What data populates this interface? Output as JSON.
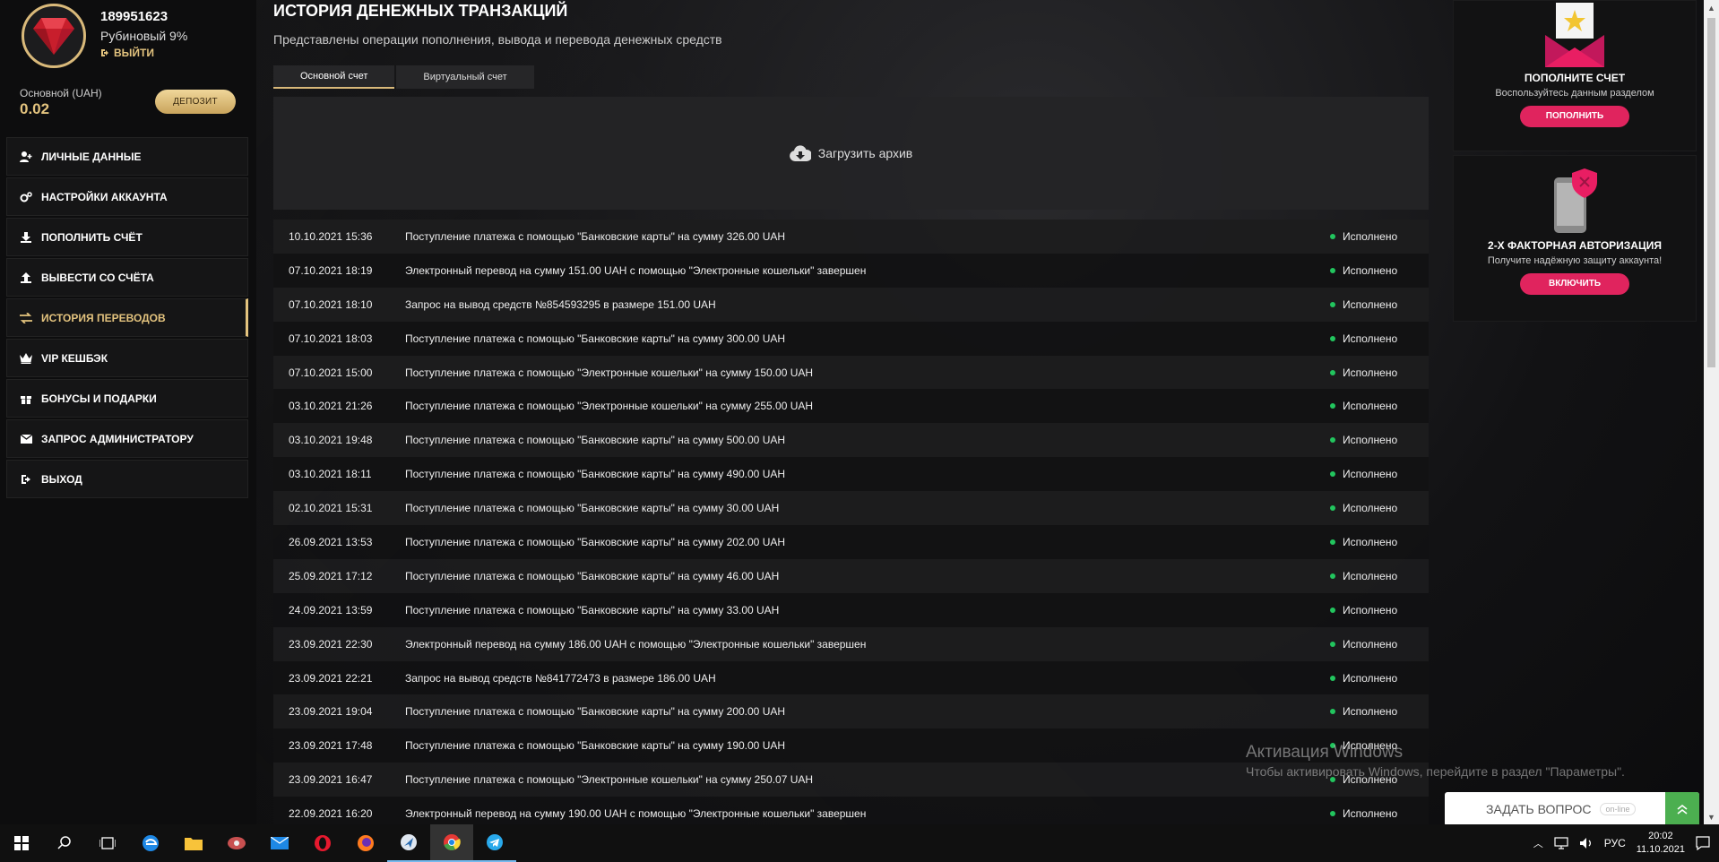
{
  "profile": {
    "user_id": "189951623",
    "status": "Рубиновый 9%",
    "logout": "ВЫЙТИ",
    "balance_label": "Основной (UAH)",
    "balance_value": "0.02",
    "deposit_label": "ДЕПОЗИТ"
  },
  "menu": [
    {
      "label": "ЛИЧНЫЕ ДАННЫЕ",
      "icon": "user-add-icon"
    },
    {
      "label": "НАСТРОЙКИ АККАУНТА",
      "icon": "gears-icon"
    },
    {
      "label": "ПОПОЛНИТЬ СЧЁТ",
      "icon": "download-icon"
    },
    {
      "label": "ВЫВЕСТИ СО СЧЁТА",
      "icon": "upload-icon"
    },
    {
      "label": "ИСТОРИЯ ПЕРЕВОДОВ",
      "icon": "exchange-icon",
      "active": true
    },
    {
      "label": "VIP КЕШБЭК",
      "icon": "crown-icon"
    },
    {
      "label": "БОНУСЫ И ПОДАРКИ",
      "icon": "gift-icon"
    },
    {
      "label": "ЗАПРОС АДМИНИСТРАТОРУ",
      "icon": "envelope-icon"
    },
    {
      "label": "ВЫХОД",
      "icon": "sign-out-icon"
    }
  ],
  "main": {
    "title": "ИСТОРИЯ ДЕНЕЖНЫХ ТРАНЗАКЦИЙ",
    "subtitle": "Представлены операции пополнения, вывода и перевода денежных средств",
    "tabs": [
      {
        "label": "Основной счет",
        "active": true
      },
      {
        "label": "Виртуальный счет",
        "active": false
      }
    ],
    "upload_label": "Загрузить архив",
    "transactions": [
      {
        "date": "10.10.2021 15:36",
        "desc": "Поступление платежа с помощью \"Банковские карты\" на сумму 326.00 UAH",
        "status": "Исполнено"
      },
      {
        "date": "07.10.2021 18:19",
        "desc": "Электронный перевод на сумму 151.00 UAH с помощью \"Электронные кошельки\" завершен",
        "status": "Исполнено"
      },
      {
        "date": "07.10.2021 18:10",
        "desc": "Запрос на вывод средств №854593295 в размере 151.00 UAH",
        "status": "Исполнено"
      },
      {
        "date": "07.10.2021 18:03",
        "desc": "Поступление платежа с помощью \"Банковские карты\" на сумму 300.00 UAH",
        "status": "Исполнено"
      },
      {
        "date": "07.10.2021 15:00",
        "desc": "Поступление платежа с помощью \"Электронные кошельки\" на сумму 150.00 UAH",
        "status": "Исполнено"
      },
      {
        "date": "03.10.2021 21:26",
        "desc": "Поступление платежа с помощью \"Электронные кошельки\" на сумму 255.00 UAH",
        "status": "Исполнено"
      },
      {
        "date": "03.10.2021 19:48",
        "desc": "Поступление платежа с помощью \"Банковские карты\" на сумму 500.00 UAH",
        "status": "Исполнено"
      },
      {
        "date": "03.10.2021 18:11",
        "desc": "Поступление платежа с помощью \"Банковские карты\" на сумму 490.00 UAH",
        "status": "Исполнено"
      },
      {
        "date": "02.10.2021 15:31",
        "desc": "Поступление платежа с помощью \"Банковские карты\" на сумму 30.00 UAH",
        "status": "Исполнено"
      },
      {
        "date": "26.09.2021 13:53",
        "desc": "Поступление платежа с помощью \"Банковские карты\" на сумму 202.00 UAH",
        "status": "Исполнено"
      },
      {
        "date": "25.09.2021 17:12",
        "desc": "Поступление платежа с помощью \"Банковские карты\" на сумму 46.00 UAH",
        "status": "Исполнено"
      },
      {
        "date": "24.09.2021 13:59",
        "desc": "Поступление платежа с помощью \"Банковские карты\" на сумму 33.00 UAH",
        "status": "Исполнено"
      },
      {
        "date": "23.09.2021 22:30",
        "desc": "Электронный перевод на сумму 186.00 UAH с помощью \"Электронные кошельки\" завершен",
        "status": "Исполнено"
      },
      {
        "date": "23.09.2021 22:21",
        "desc": "Запрос на вывод средств №841772473 в размере 186.00 UAH",
        "status": "Исполнено"
      },
      {
        "date": "23.09.2021 19:04",
        "desc": "Поступление платежа с помощью \"Банковские карты\" на сумму 200.00 UAH",
        "status": "Исполнено"
      },
      {
        "date": "23.09.2021 17:48",
        "desc": "Поступление платежа с помощью \"Банковские карты\" на сумму 190.00 UAH",
        "status": "Исполнено"
      },
      {
        "date": "23.09.2021 16:47",
        "desc": "Поступление платежа с помощью \"Электронные кошельки\" на сумму 250.07 UAH",
        "status": "Исполнено"
      },
      {
        "date": "22.09.2021 16:20",
        "desc": "Электронный перевод на сумму 190.00 UAH с помощью \"Электронные кошельки\" завершен",
        "status": "Исполнено"
      }
    ]
  },
  "promos": {
    "deposit": {
      "title": "ПОПОЛНИТЕ СЧЕТ",
      "text": "Воспользуйтесь данным разделом",
      "button": "ПОПОЛНИТЬ"
    },
    "twofa": {
      "title": "2-Х ФАКТОРНАЯ АВТОРИЗАЦИЯ",
      "text": "Получите надёжную защиту аккаунта!",
      "button": "ВКЛЮЧИТЬ"
    }
  },
  "watermark": {
    "title": "Активация Windows",
    "text": "Чтобы активировать Windows, перейдите в раздел \"Параметры\"."
  },
  "chat_widget": {
    "label": "ЗАДАТЬ ВОПРОС",
    "badge": "on-line"
  },
  "taskbar": {
    "language": "РУС",
    "time": "20:02",
    "date": "11.10.2021"
  },
  "colors": {
    "accent_gold": "#e3c37e",
    "accent_pink": "#e0245e",
    "status_ok": "#22c55e"
  }
}
